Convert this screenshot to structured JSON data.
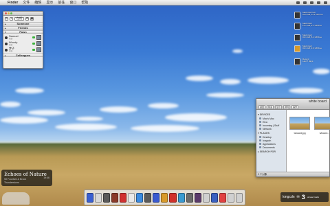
{
  "menubar": {
    "apple": "",
    "items": [
      "Finder",
      "文件",
      "编辑",
      "显示",
      "前往",
      "窗口",
      "帮助"
    ]
  },
  "contacts": {
    "status_select": "在线",
    "groups": [
      {
        "label": "Someone"
      },
      {
        "label": "Friends"
      },
      {
        "label": "Pawn"
      },
      {
        "label": "Colleagues"
      }
    ],
    "buddies": [
      {
        "name": "Samuel",
        "sub": "在线"
      },
      {
        "name": "Woody",
        "sub": "在线"
      },
      {
        "name": "梦子",
        "sub": "在线"
      }
    ]
  },
  "widgets": [
    {
      "line1": "Macintosh HD",
      "line2": "93.6 GB, 12.1 GB free"
    },
    {
      "line1": "Macintosh",
      "line2": "15.1 GB, 9.1 GB free"
    },
    {
      "line1": "Macintosh",
      "line2": "93.1 GB, 8.1 GB free"
    },
    {
      "line1": "Macintosh",
      "line2": "93.1 GB, 9.0 GB free"
    },
    {
      "line1": "Recent",
      "line2": "Last 7 days"
    }
  ],
  "now_playing": {
    "title": "Echoes of Nature",
    "artist": "Sit Fountain & Brook",
    "album": "Thunderstorm",
    "time": "19:46"
  },
  "finder": {
    "title": "white board",
    "nav": [
      "返回",
      "前进",
      "显示",
      "排列",
      "操作"
    ],
    "devices_header": "DEVICES",
    "devices": [
      "Mac's Mac",
      "Elva",
      "Incoming | Stuff",
      "Network"
    ],
    "places_header": "PLACES",
    "places": [
      "Desktop",
      "longcdn",
      "Applications",
      "Documents"
    ],
    "search_header": "SEARCH FOR",
    "files": [
      {
        "name": "wboard.jpg"
      },
      {
        "name": "wboard..."
      }
    ],
    "status": "2 个对象"
  },
  "dock": {
    "colors": [
      "#3a5fd1",
      "#d9d9d9",
      "#5a5a5a",
      "#8a3a2a",
      "#d03030",
      "#e8e8e8",
      "#3a8ae0",
      "#5a5a5a",
      "#3a5ad0",
      "#d89a2a",
      "#d0302a",
      "#3a9ad0",
      "#6a6a6a",
      "#5a3a6a",
      "#d0d0d0",
      "#3a60c0",
      "#e04040",
      "#d0d0d0",
      "#d0d0d0"
    ]
  },
  "tray": {
    "user": "longcdn",
    "count": "3",
    "unread": "unread mails"
  }
}
